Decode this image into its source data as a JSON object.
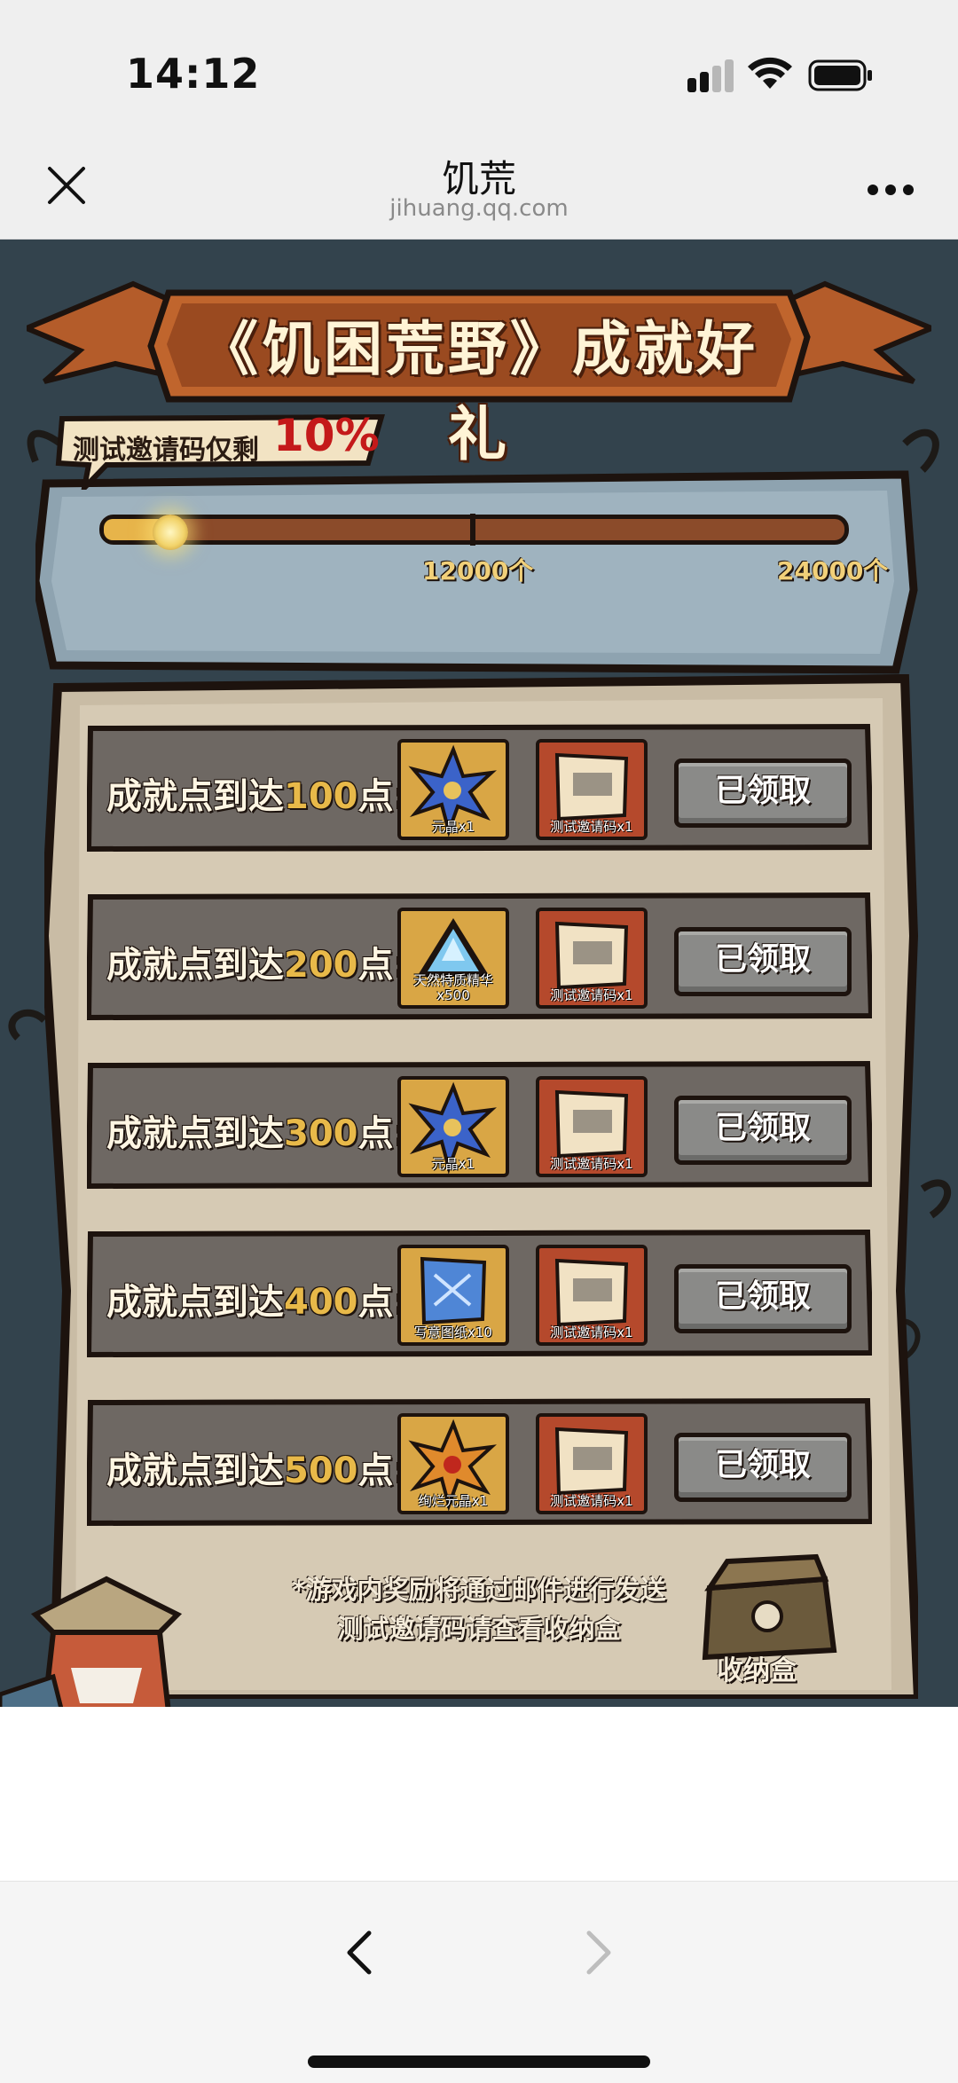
{
  "status": {
    "time": "14:12"
  },
  "browser": {
    "title": "饥荒",
    "url": "jihuang.qq.com"
  },
  "banner": {
    "title": "《饥困荒野》成就好礼"
  },
  "progress": {
    "label": "测试邀请码仅剩",
    "percent_text": "10%",
    "fill_fraction": 0.1,
    "milestones": [
      "12000个",
      "24000个"
    ]
  },
  "rewards": [
    {
      "prefix": "成就点到达",
      "points": "100",
      "suffix": "点:",
      "item1": "元晶x1",
      "item1_icon": "star-crystal-icon",
      "item2": "测试邀请码x1",
      "item2_icon": "scroll-icon",
      "button": "已领取"
    },
    {
      "prefix": "成就点到达",
      "points": "200",
      "suffix": "点:",
      "item1": "天然特质精华x500",
      "item1_icon": "blue-gem-icon",
      "item2": "测试邀请码x1",
      "item2_icon": "scroll-icon",
      "button": "已领取"
    },
    {
      "prefix": "成就点到达",
      "points": "300",
      "suffix": "点:",
      "item1": "元晶x1",
      "item1_icon": "star-crystal-icon",
      "item2": "测试邀请码x1",
      "item2_icon": "scroll-icon",
      "button": "已领取"
    },
    {
      "prefix": "成就点到达",
      "points": "400",
      "suffix": "点:",
      "item1": "写意图纸x10",
      "item1_icon": "blueprint-icon",
      "item2": "测试邀请码x1",
      "item2_icon": "scroll-icon",
      "button": "已领取"
    },
    {
      "prefix": "成就点到达",
      "points": "500",
      "suffix": "点:",
      "item1": "绚烂元晶x1",
      "item1_icon": "radiant-crystal-icon",
      "item2": "测试邀请码x1",
      "item2_icon": "scroll-icon",
      "button": "已领取"
    }
  ],
  "note": {
    "line1": "*游戏内奖励将通过邮件进行发送",
    "line2": "测试邀请码请查看收纳盒"
  },
  "storage_box": {
    "label": "收纳盒"
  },
  "colors": {
    "points": "#e8b949",
    "percent": "#c41a1a",
    "claimed_button": "#8a8a88"
  }
}
